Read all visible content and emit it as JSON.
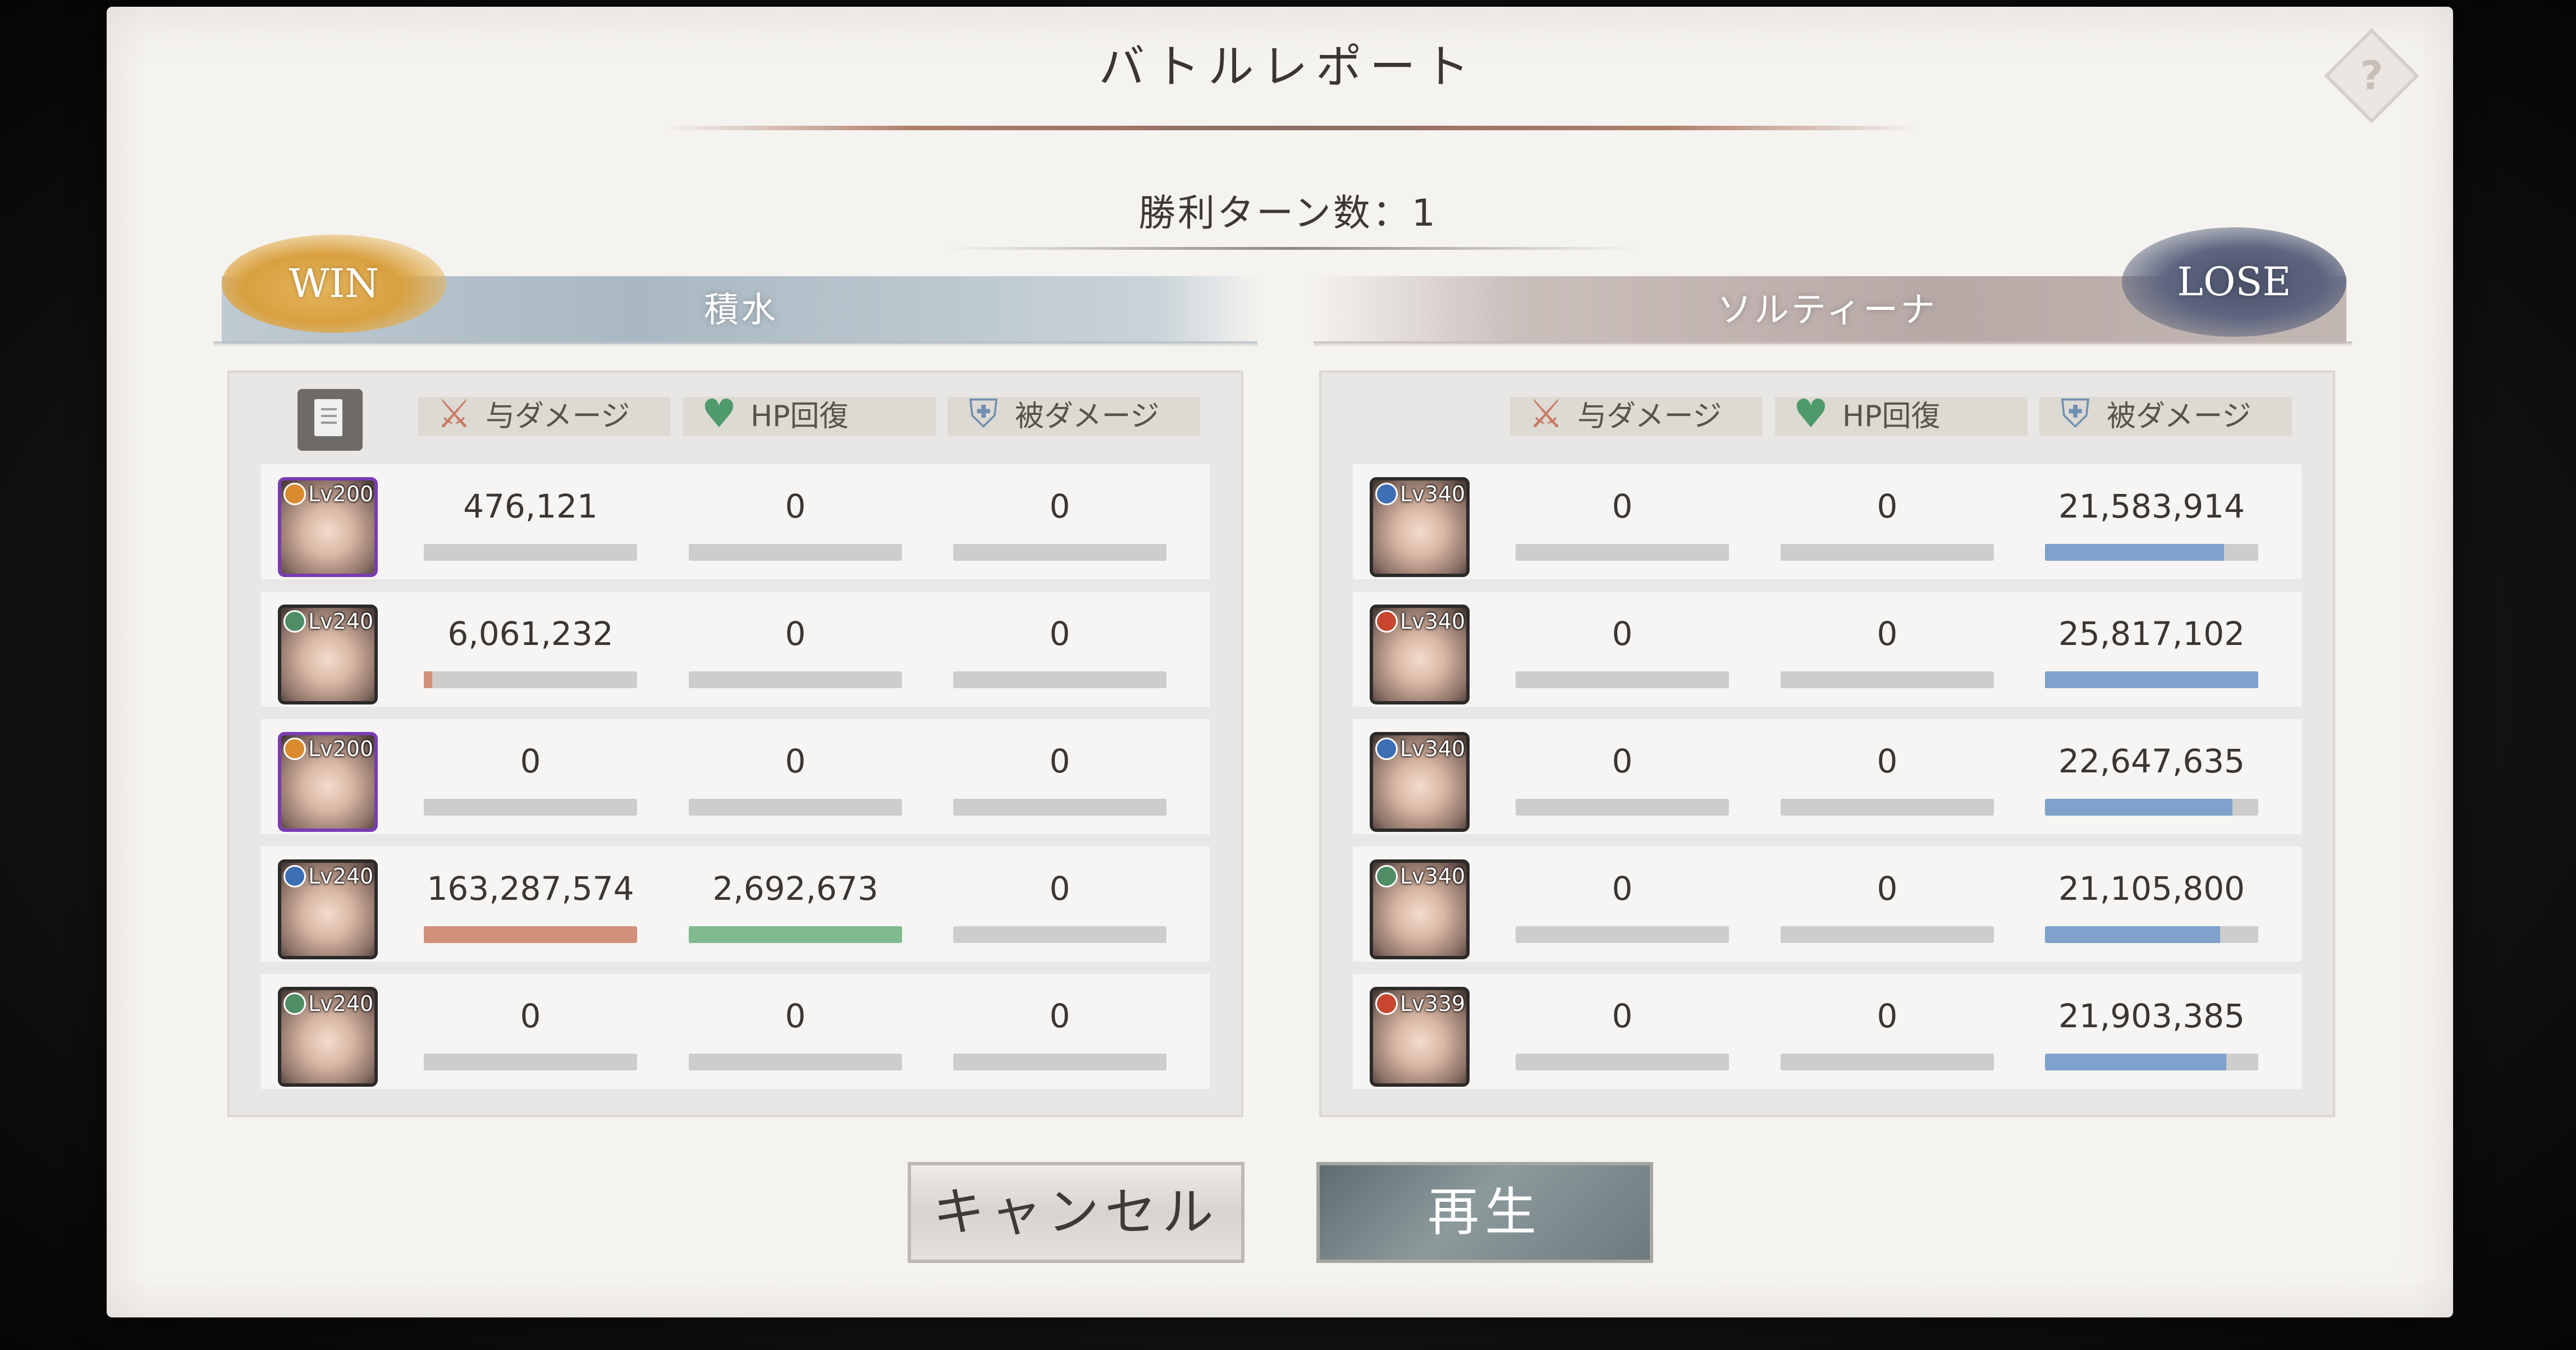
{
  "title": "バトルレポート",
  "victory_turns": "勝利ターン数：1",
  "help_icon": "?",
  "left_team": {
    "result": "WIN",
    "name": "積水",
    "headers": {
      "damage": "与ダメージ",
      "heal": "HP回復",
      "taken": "被ダメージ"
    },
    "rows": [
      {
        "level": "Lv200",
        "element_color": "#d98a2f",
        "frame": "purple",
        "damage": "476,121",
        "heal": "0",
        "taken": "0",
        "damage_fill": 0.0,
        "heal_fill": 0.0,
        "taken_fill": 0.0
      },
      {
        "level": "Lv240",
        "element_color": "#4f8d66",
        "frame": "dark",
        "damage": "6,061,232",
        "heal": "0",
        "taken": "0",
        "damage_fill": 0.04,
        "heal_fill": 0.0,
        "taken_fill": 0.0
      },
      {
        "level": "Lv200",
        "element_color": "#d98a2f",
        "frame": "purple",
        "damage": "0",
        "heal": "0",
        "taken": "0",
        "damage_fill": 0.0,
        "heal_fill": 0.0,
        "taken_fill": 0.0
      },
      {
        "level": "Lv240",
        "element_color": "#3d6fb4",
        "frame": "dark",
        "damage": "163,287,574",
        "heal": "2,692,673",
        "taken": "0",
        "damage_fill": 1.0,
        "heal_fill": 1.0,
        "taken_fill": 0.0
      },
      {
        "level": "Lv240",
        "element_color": "#4f8d66",
        "frame": "dark",
        "damage": "0",
        "heal": "0",
        "taken": "0",
        "damage_fill": 0.0,
        "heal_fill": 0.0,
        "taken_fill": 0.0
      }
    ]
  },
  "right_team": {
    "result": "LOSE",
    "name": "ソルティーナ",
    "headers": {
      "damage": "与ダメージ",
      "heal": "HP回復",
      "taken": "被ダメージ"
    },
    "rows": [
      {
        "level": "Lv340",
        "element_color": "#3d6fb4",
        "frame": "dark",
        "damage": "0",
        "heal": "0",
        "taken": "21,583,914",
        "damage_fill": 0.0,
        "heal_fill": 0.0,
        "taken_fill": 0.84
      },
      {
        "level": "Lv340",
        "element_color": "#c8462f",
        "frame": "dark",
        "damage": "0",
        "heal": "0",
        "taken": "25,817,102",
        "damage_fill": 0.0,
        "heal_fill": 0.0,
        "taken_fill": 1.0
      },
      {
        "level": "Lv340",
        "element_color": "#3d6fb4",
        "frame": "dark",
        "damage": "0",
        "heal": "0",
        "taken": "22,647,635",
        "damage_fill": 0.0,
        "heal_fill": 0.0,
        "taken_fill": 0.88
      },
      {
        "level": "Lv340",
        "element_color": "#4f8d66",
        "frame": "dark",
        "damage": "0",
        "heal": "0",
        "taken": "21,105,800",
        "damage_fill": 0.0,
        "heal_fill": 0.0,
        "taken_fill": 0.82
      },
      {
        "level": "Lv339",
        "element_color": "#c8462f",
        "frame": "dark",
        "damage": "0",
        "heal": "0",
        "taken": "21,903,385",
        "damage_fill": 0.0,
        "heal_fill": 0.0,
        "taken_fill": 0.85
      }
    ]
  },
  "buttons": {
    "cancel": "キャンセル",
    "play": "再生"
  },
  "colors": {
    "damage_bar": "#d2907b",
    "heal_bar": "#7fbb8e",
    "taken_bar": "#7ea2cb",
    "win_badge": "#d9a040",
    "lose_badge": "#5d6580"
  }
}
